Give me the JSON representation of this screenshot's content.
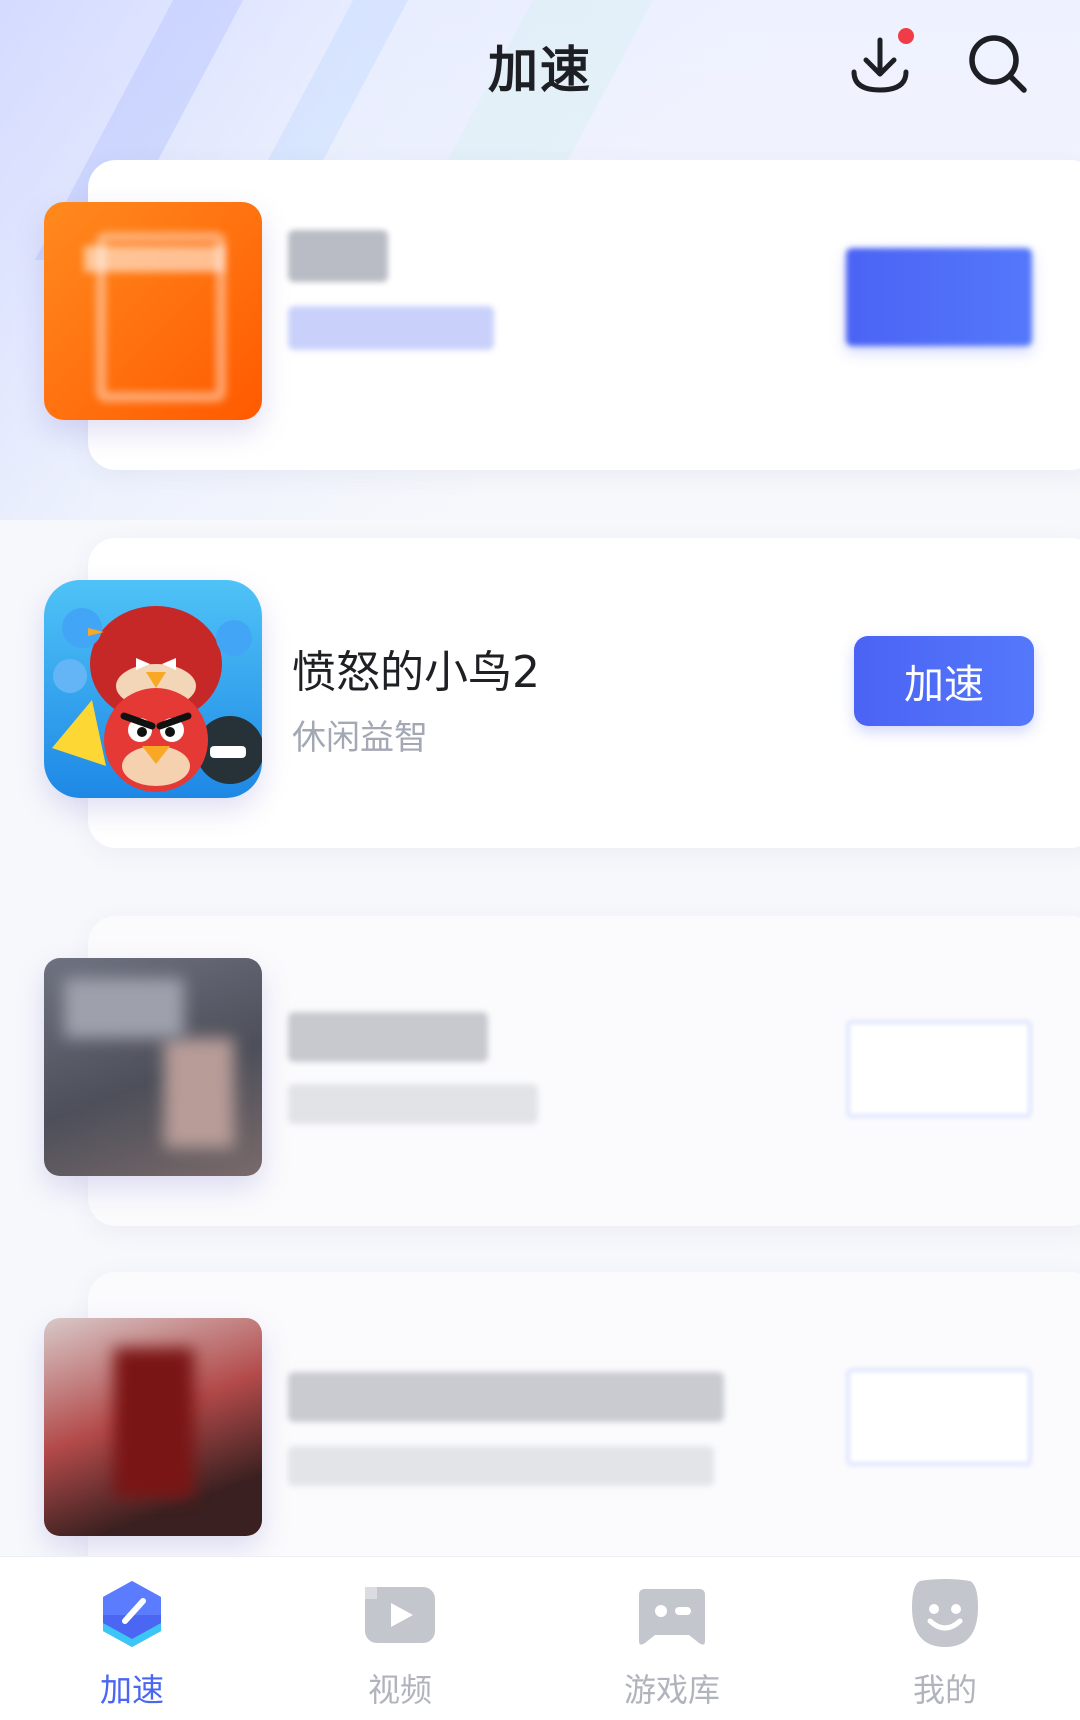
{
  "header": {
    "title": "加速",
    "download_icon": "download-icon",
    "search_icon": "search-icon",
    "notification_dot_color": "#f03c46"
  },
  "games": [
    {
      "name": "",
      "category": "",
      "button_label": "",
      "obscured": true,
      "button_style": "filled"
    },
    {
      "name": "愤怒的小鸟2",
      "category": "休闲益智",
      "button_label": "加速",
      "obscured": false,
      "button_style": "filled"
    },
    {
      "name": "",
      "category": "",
      "button_label": "",
      "obscured": true,
      "button_style": "outline"
    },
    {
      "name": "",
      "category": "",
      "button_label": "",
      "obscured": true,
      "button_style": "outline"
    }
  ],
  "nav": {
    "items": [
      {
        "label": "加速",
        "icon": "speedometer-icon",
        "active": true
      },
      {
        "label": "视频",
        "icon": "video-icon",
        "active": false
      },
      {
        "label": "游戏库",
        "icon": "gamepad-icon",
        "active": false
      },
      {
        "label": "我的",
        "icon": "smiley-icon",
        "active": false
      }
    ]
  },
  "colors": {
    "accent": "#4b63f4",
    "text_primary": "#1f2024",
    "text_secondary": "#a3a8b4",
    "nav_inactive": "#b1b4bd"
  }
}
